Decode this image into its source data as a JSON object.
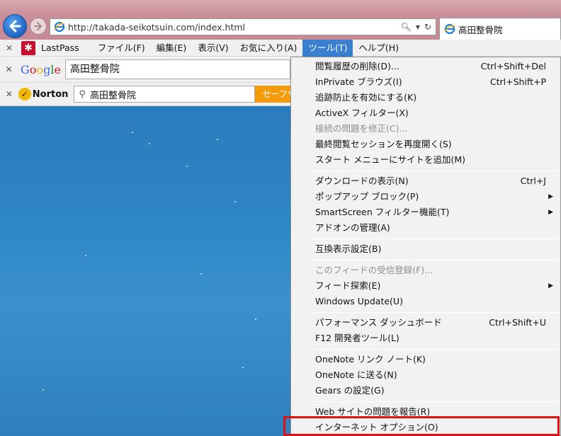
{
  "address_bar": {
    "url": "http://takada-seikotsuin.com/index.html"
  },
  "tab": {
    "title": "高田整骨院"
  },
  "menubar": {
    "lastpass_label": "LastPass",
    "items": [
      {
        "label": "ファイル(F)"
      },
      {
        "label": "編集(E)"
      },
      {
        "label": "表示(V)"
      },
      {
        "label": "お気に入り(A)"
      },
      {
        "label": "ツール(T)"
      },
      {
        "label": "ヘルプ(H)"
      }
    ]
  },
  "google_bar": {
    "query": "高田整骨院"
  },
  "norton_bar": {
    "brand": "Norton",
    "query": "高田整骨院",
    "safe_search": "セーフサーチ"
  },
  "tools_menu": {
    "items": [
      {
        "label": "閲覧履歴の削除(D)...",
        "shortcut": "Ctrl+Shift+Del"
      },
      {
        "label": "InPrivate ブラウズ(I)",
        "shortcut": "Ctrl+Shift+P"
      },
      {
        "label": "追跡防止を有効にする(K)",
        "shortcut": ""
      },
      {
        "label": "ActiveX フィルター(X)",
        "shortcut": ""
      },
      {
        "label": "接続の問題を修正(C)...",
        "shortcut": ""
      },
      {
        "label": "最終閲覧セッションを再度開く(S)",
        "shortcut": ""
      },
      {
        "label": "スタート メニューにサイトを追加(M)",
        "shortcut": ""
      },
      {
        "label": "ダウンロードの表示(N)",
        "shortcut": "Ctrl+J"
      },
      {
        "label": "ポップアップ ブロック(P)",
        "shortcut": ""
      },
      {
        "label": "SmartScreen フィルター機能(T)",
        "shortcut": ""
      },
      {
        "label": "アドオンの管理(A)",
        "shortcut": ""
      },
      {
        "label": "互換表示設定(B)",
        "shortcut": ""
      },
      {
        "label": "このフィードの受信登録(F)...",
        "shortcut": ""
      },
      {
        "label": "フィード探索(E)",
        "shortcut": ""
      },
      {
        "label": "Windows Update(U)",
        "shortcut": ""
      },
      {
        "label": "パフォーマンス ダッシュボード",
        "shortcut": "Ctrl+Shift+U"
      },
      {
        "label": "F12 開発者ツール(L)",
        "shortcut": ""
      },
      {
        "label": "OneNote リンク ノート(K)",
        "shortcut": ""
      },
      {
        "label": "OneNote に送る(N)",
        "shortcut": ""
      },
      {
        "label": "Gears の設定(G)",
        "shortcut": ""
      },
      {
        "label": "Web サイトの問題を報告(R)",
        "shortcut": ""
      },
      {
        "label": "インターネット オプション(O)",
        "shortcut": ""
      }
    ]
  },
  "colors": {
    "menu_highlight": "#3a7fd0",
    "annotation_box": "#e01010"
  }
}
